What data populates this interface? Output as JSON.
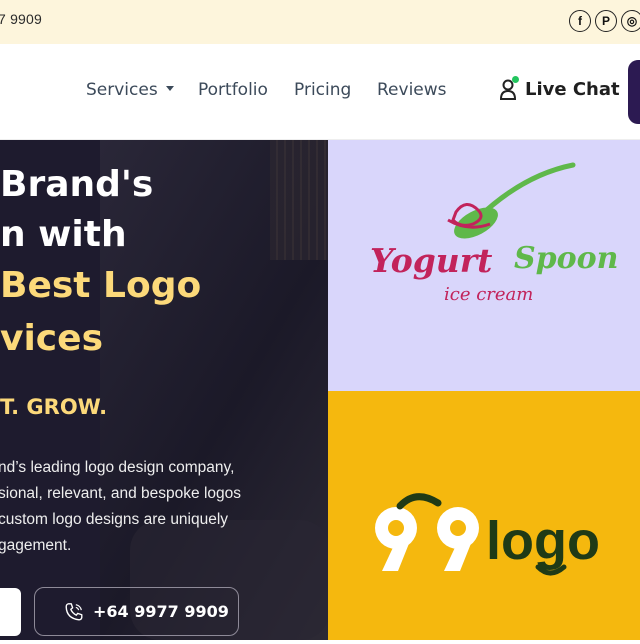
{
  "topbar": {
    "phone": "7 9909",
    "social": [
      {
        "icon": "facebook-icon",
        "glyph": "f"
      },
      {
        "icon": "pinterest-icon",
        "glyph": "P"
      },
      {
        "icon": "instagram-icon",
        "glyph": "◎"
      }
    ]
  },
  "nav": {
    "items": [
      "Services",
      "Portfolio",
      "Pricing",
      "Reviews"
    ],
    "live_chat": "Live Chat"
  },
  "hero": {
    "line1": "Brand's",
    "line2": "n with",
    "line3": "Best Logo",
    "line4": "vices",
    "tagline": "T. GROW.",
    "desc": [
      "nd’s leading logo design company,",
      "sional, relevant, and bespoke logos",
      "custom logo designs are uniquely",
      "gagement."
    ],
    "phone_button": "+64 9977 9909"
  },
  "portfolio": {
    "logo1": {
      "main": "Yogurt Spoon",
      "sub": "ice cream"
    },
    "logo2": {
      "number": "99",
      "word": "logo"
    }
  },
  "colors": {
    "topbar_bg": "#fdf5dc",
    "hero_bg": "#1e1b2e",
    "accent_yellow": "#fcd97a",
    "lavender": "#d9d6fb",
    "gold": "#f5b80e",
    "logo_pink": "#c2235b",
    "logo_green": "#5fb84a",
    "dark_green": "#1f3a16",
    "live_dot": "#22c55e"
  }
}
